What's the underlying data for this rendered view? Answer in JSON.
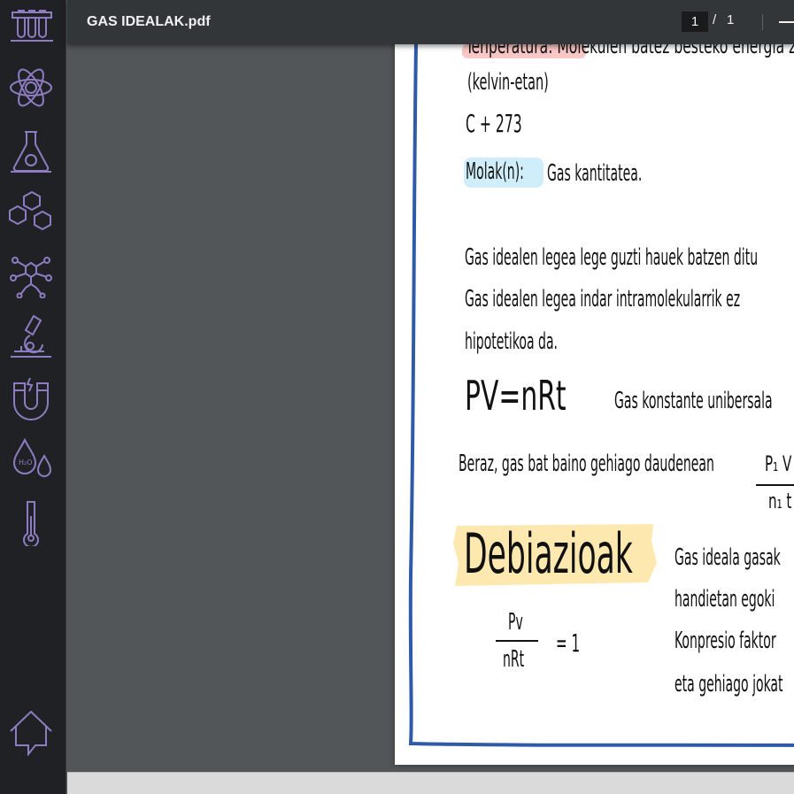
{
  "sidebar": {
    "items": [
      {
        "icon": "test-tubes-icon"
      },
      {
        "icon": "atom-icon"
      },
      {
        "icon": "flask-biohazard-icon"
      },
      {
        "icon": "hexagon-molecule-icon"
      },
      {
        "icon": "molecule-network-icon"
      },
      {
        "icon": "microscope-icon"
      },
      {
        "icon": "magnet-icon"
      },
      {
        "icon": "water-drops-icon",
        "label": "H2O"
      },
      {
        "icon": "thermometer-icon"
      },
      {
        "icon": "home-icon"
      }
    ],
    "accent": "#8e7cc3"
  },
  "toolbar": {
    "title": "GAS IDEALAK.pdf",
    "page_current": "1",
    "page_separator": "/",
    "page_total": "1"
  },
  "document": {
    "line_top_partial": "Tenperatura: Molekulen batez besteko energia zinetikoa",
    "kelvin": "(kelvin-etan)",
    "celsius": "C + 273",
    "molak_term": "Molak(n):",
    "molak_def": "Gas kantitatea.",
    "ideal_law_1": "Gas idealen legea lege guzti hauek batzen ditu",
    "ideal_law_2": "Gas idealen legea indar intramolekularrik ez",
    "ideal_law_3": "hipotetikoa da.",
    "equation": "PV=nRt",
    "gas_constant": "Gas konstante unibersala",
    "beraz": "Beraz, gas bat baino gehiago daudenean",
    "frac_num": "P₁ V",
    "frac_den": "n₁ t",
    "debiazioak": "Debiazioak",
    "dev_1": "Gas ideala gasak",
    "dev_2": "handietan egoki",
    "dev_3": "Konpresio faktor",
    "dev_4": "eta gehiago jokat",
    "pv": "Pv",
    "nrt": "nRt",
    "eq_one": "= 1",
    "colors": {
      "border": "#2f5aa8",
      "pink": "#f9c7c5",
      "blue": "#cfeefa",
      "yellow": "#fde9b0"
    }
  }
}
